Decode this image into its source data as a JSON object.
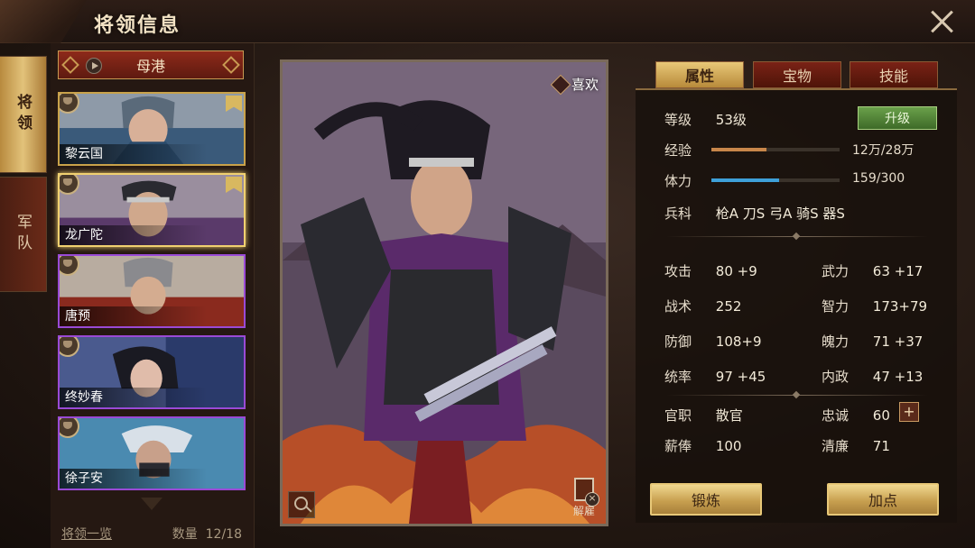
{
  "header": {
    "title": "将领信息"
  },
  "side_tabs": [
    "将领",
    "军队"
  ],
  "location": "母港",
  "generals": [
    {
      "name": "黎云国"
    },
    {
      "name": "龙广陀"
    },
    {
      "name": "唐预"
    },
    {
      "name": "终妙春"
    },
    {
      "name": "徐子安"
    }
  ],
  "list_footer": {
    "link": "将领一览",
    "count_label": "数量",
    "count": "12/18"
  },
  "portrait": {
    "like_label": "喜欢",
    "dismiss_label": "解雇"
  },
  "tabs": [
    "属性",
    "宝物",
    "技能"
  ],
  "attributes": {
    "level_label": "等级",
    "level": "53级",
    "upgrade": "升级",
    "exp_label": "经验",
    "exp": "12万/28万",
    "exp_fraction": 0.43,
    "stamina_label": "体力",
    "stamina": "159/300",
    "stamina_fraction": 0.53,
    "arms_label": "兵科",
    "arms": "枪A 刀S 弓A 骑S 器S",
    "stats_left": [
      {
        "label": "攻击",
        "value": "80 +9"
      },
      {
        "label": "战术",
        "value": "252"
      },
      {
        "label": "防御",
        "value": "108+9"
      },
      {
        "label": "统率",
        "value": "97 +45"
      }
    ],
    "stats_right": [
      {
        "label": "武力",
        "value": "63 +17"
      },
      {
        "label": "智力",
        "value": "173+79"
      },
      {
        "label": "魄力",
        "value": "71 +37"
      },
      {
        "label": "内政",
        "value": "47 +13"
      }
    ],
    "office_label": "官职",
    "office": "散官",
    "loyalty_label": "忠诚",
    "loyalty": "60",
    "salary_label": "薪俸",
    "salary": "100",
    "integrity_label": "清廉",
    "integrity": "71"
  },
  "buttons": {
    "forge": "锻炼",
    "add_points": "加点"
  },
  "colors": {
    "exp_bar": "#c8864a",
    "stamina_bar": "#3ea0d8",
    "accent_gold": "#e2c27a",
    "upgrade_green": "#5a9a3e"
  }
}
